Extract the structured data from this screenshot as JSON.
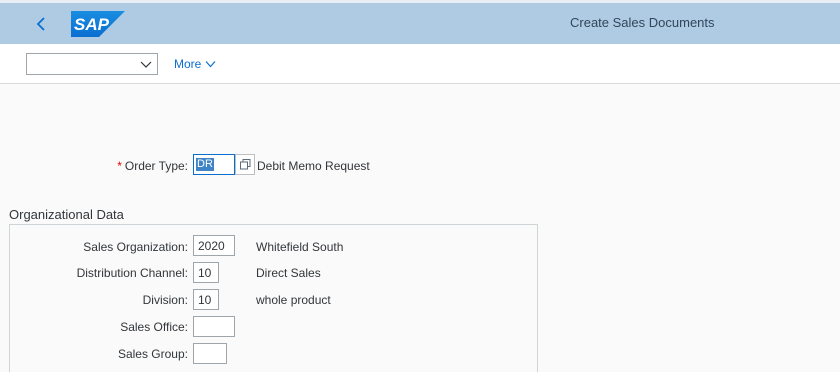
{
  "shell": {
    "title": "Create Sales Documents",
    "logo_text": "SAP",
    "brand_color": "#0a6ed1"
  },
  "toolbar": {
    "select_value": "",
    "more_label": "More"
  },
  "order_type": {
    "label": "Order Type:",
    "required": "*",
    "value": "DR",
    "description": "Debit Memo Request"
  },
  "org_data": {
    "title": "Organizational Data",
    "fields": [
      {
        "label": "Sales Organization:",
        "value": "2020",
        "description": "Whitefield South"
      },
      {
        "label": "Distribution Channel:",
        "value": "10",
        "description": "Direct Sales"
      },
      {
        "label": "Division:",
        "value": "10",
        "description": "whole product"
      },
      {
        "label": "Sales Office:",
        "value": "",
        "description": ""
      },
      {
        "label": "Sales Group:",
        "value": "",
        "description": ""
      }
    ]
  }
}
